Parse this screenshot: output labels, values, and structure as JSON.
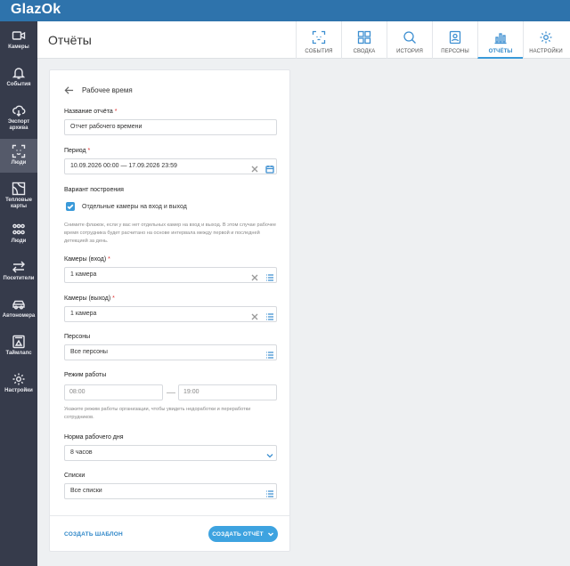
{
  "app": {
    "logo": "GlazOk"
  },
  "sidebar": {
    "items": [
      {
        "label": "Камеры",
        "icon": "camera-icon"
      },
      {
        "label": "События",
        "icon": "bell-icon"
      },
      {
        "label": "Экспорт архива",
        "icon": "cloud-download-icon"
      },
      {
        "label": "Люди",
        "icon": "face-scan-icon",
        "active": true
      },
      {
        "label": "Тепловые карты",
        "icon": "heatmap-icon"
      },
      {
        "label": "Люди",
        "icon": "people-icon"
      },
      {
        "label": "Посетители",
        "icon": "arrows-icon"
      },
      {
        "label": "Автономера",
        "icon": "car-icon"
      },
      {
        "label": "Таймлапс",
        "icon": "timelapse-icon"
      },
      {
        "label": "Настройки",
        "icon": "gear-icon"
      }
    ]
  },
  "header": {
    "title": "Отчёты",
    "tabs": [
      {
        "label": "СОБЫТИЯ",
        "icon": "scan-icon"
      },
      {
        "label": "СВОДКА",
        "icon": "grid-icon"
      },
      {
        "label": "ИСТОРИЯ",
        "icon": "search-icon"
      },
      {
        "label": "ПЕРСОНЫ",
        "icon": "person-card-icon"
      },
      {
        "label": "ОТЧЁТЫ",
        "icon": "bar-chart-icon",
        "active": true
      },
      {
        "label": "НАСТРОЙКИ",
        "icon": "gear-icon"
      }
    ]
  },
  "form": {
    "title": "Рабочее время",
    "report_name_label": "Название отчёта",
    "report_name_value": "Отчет рабочего времени",
    "period_label": "Период",
    "period_value": "10.09.2026 00:00 — 17.09.2026 23:59",
    "variant_label": "Вариант построения",
    "separate_cameras_label": "Отдельные камеры на вход и выход",
    "separate_cameras_checked": true,
    "separate_cameras_hint": "Снимите флажок, если у вас нет отдельных камер на вход и выход. В этом случае рабочее время сотрудника будет расчитано на основе интервала между первой и последней детекцией за день.",
    "cameras_in_label": "Камеры (вход)",
    "cameras_in_value": "1 камера",
    "cameras_out_label": "Камеры (выход)",
    "cameras_out_value": "1 камера",
    "persons_label": "Персоны",
    "persons_value": "Все персоны",
    "work_mode_label": "Режим работы",
    "work_start": "08:00",
    "work_end": "19:00",
    "work_mode_hint": "Укажите режим работы организации, чтобы увидеть недоработки и переработки сотрудников.",
    "day_norm_label": "Норма рабочего дня",
    "day_norm_value": "8 часов",
    "lists_label": "Списки",
    "lists_value": "Все списки",
    "required_mark": "*"
  },
  "footer": {
    "create_template": "СОЗДАТЬ ШАБЛОН",
    "create_report": "СОЗДАТЬ ОТЧЁТ"
  }
}
